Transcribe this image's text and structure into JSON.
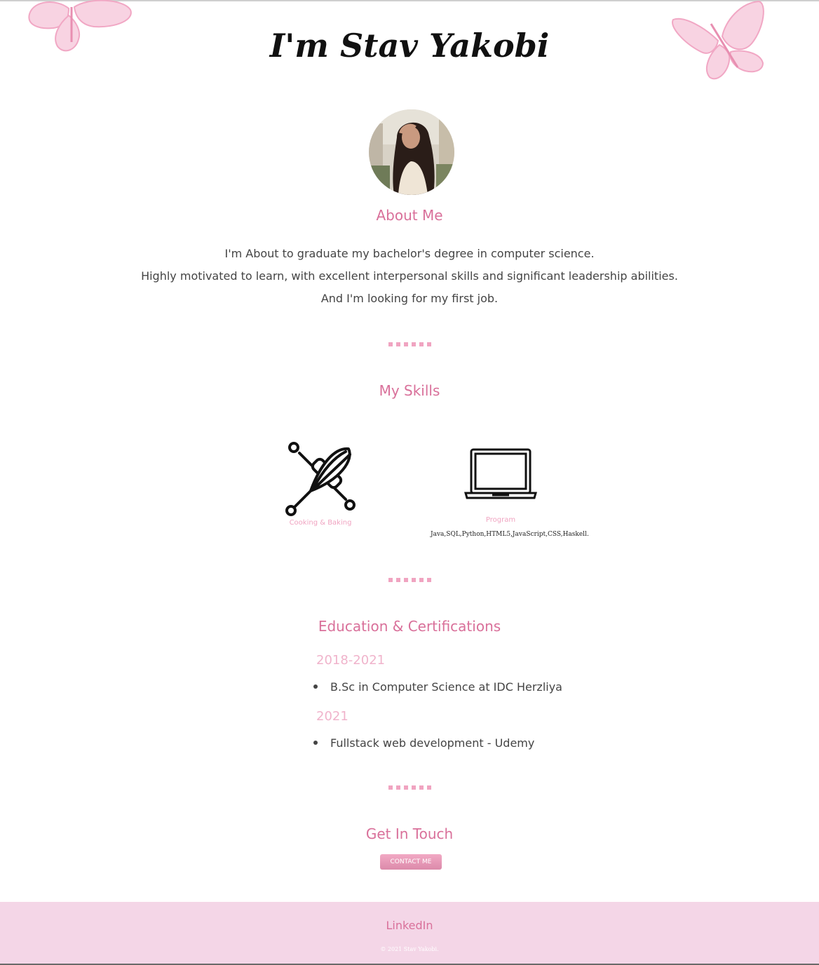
{
  "header": {
    "title": "I'm Stav Yakobi"
  },
  "about": {
    "heading": "About Me",
    "lines": [
      "I'm About to graduate my bachelor's degree in computer science.",
      "Highly motivated to learn, with excellent interpersonal skills and significant leadership abilities.",
      "And I'm looking for my first job."
    ]
  },
  "skills": {
    "heading": "My Skills",
    "items": [
      {
        "label": "Cooking & Baking",
        "icon": "whisk-rolling-pin-icon"
      },
      {
        "label": "Program",
        "detail": "Java,SQL,Python,HTML5,JavaScript,CSS,Haskell.",
        "icon": "laptop-icon"
      }
    ]
  },
  "education": {
    "heading": "Education & Certifications",
    "entries": [
      {
        "year": "2018-2021",
        "item": "B.Sc in Computer Science at IDC Herzliya"
      },
      {
        "year": "2021",
        "item": "Fullstack web development - Udemy"
      }
    ]
  },
  "contact": {
    "heading": "Get In Touch",
    "button_label": "CONTACT ME"
  },
  "footer": {
    "link": "LinkedIn",
    "copyright": "© 2021 Stav Yakobi."
  },
  "colors": {
    "accent": "#d9709a",
    "light_pink": "#f0a4c1",
    "footer_bg": "#f4d6e7"
  }
}
